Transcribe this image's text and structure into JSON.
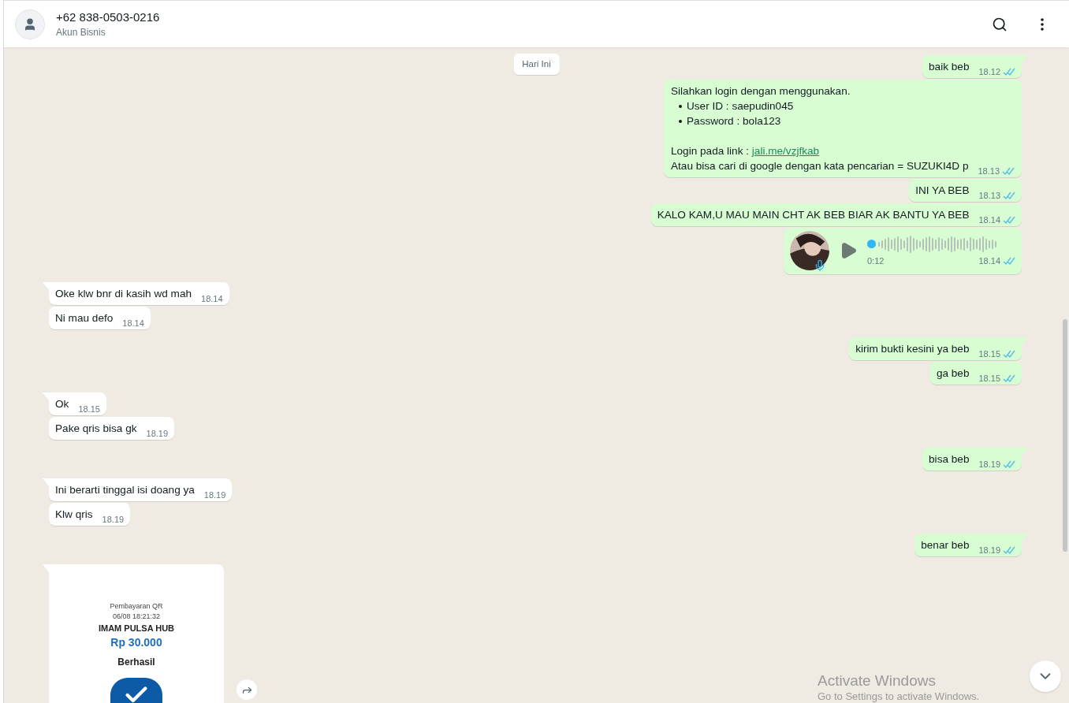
{
  "header": {
    "title": "+62 838-0503-0216",
    "subtitle": "Akun Bisnis"
  },
  "date_chip": "Hari Ini",
  "messages": [
    {
      "outgoing": true,
      "kind": "text",
      "text": "baik beb",
      "time": "18.12",
      "read": true
    },
    {
      "outgoing": true,
      "kind": "rich",
      "blocks": [
        {
          "kind": "text",
          "text": "Silahkan login dengan menggunakan."
        },
        {
          "kind": "list",
          "items": [
            "User ID : saepudin045",
            "Password : bola123"
          ]
        },
        {
          "kind": "link_line",
          "text": "Login pada link : ",
          "link": "jali.me/vzjfkab"
        },
        {
          "kind": "text",
          "text": "Atau bisa cari di google dengan kata pencarian = SUZUKI4D p"
        }
      ],
      "time": "18.13",
      "read": true
    },
    {
      "outgoing": true,
      "kind": "text",
      "text": "INI YA BEB",
      "time": "18.13",
      "read": true
    },
    {
      "outgoing": true,
      "kind": "text",
      "text": "KALO KAM,U MAU MAIN CHT AK BEB BIAR AK BANTU YA BEB",
      "time": "18.14",
      "read": true
    },
    {
      "outgoing": true,
      "kind": "voice",
      "duration": "0:12",
      "level": 0,
      "time": "18.14",
      "read": true
    },
    {
      "outgoing": false,
      "kind": "text",
      "text": "Oke klw bnr di kasih wd mah",
      "time": "18.14"
    },
    {
      "outgoing": false,
      "kind": "text",
      "text": "Ni mau defo",
      "time": "18.14"
    },
    {
      "outgoing": true,
      "kind": "text",
      "text": "kirim bukti kesini ya beb",
      "time": "18.15",
      "read": true
    },
    {
      "outgoing": true,
      "kind": "text",
      "text": "ga beb",
      "time": "18.15",
      "read": true
    },
    {
      "outgoing": false,
      "kind": "text",
      "text": "Ok",
      "time": "18.15"
    },
    {
      "outgoing": false,
      "kind": "text",
      "text": "Pake qris bisa gk",
      "time": "18.19"
    },
    {
      "outgoing": true,
      "kind": "text",
      "text": "bisa beb",
      "time": "18.19",
      "read": true
    },
    {
      "outgoing": false,
      "kind": "text",
      "text": "Ini berarti tinggal isi doang ya",
      "time": "18.19"
    },
    {
      "outgoing": false,
      "kind": "text",
      "text": "Klw qris",
      "time": "18.19"
    },
    {
      "outgoing": true,
      "kind": "text",
      "text": "benar beb",
      "time": "18.19",
      "read": true
    },
    {
      "outgoing": false,
      "receipt": {
        "title": "Pembayaran QR",
        "datetime": "06/08 18:21:32",
        "merchant": "IMAM PULSA HUB",
        "amount": "Rp 30.000",
        "status": "Berhasil"
      }
    }
  ],
  "overlay": {
    "line1": "Activate Windows",
    "line2": "Go to Settings to activate Windows."
  }
}
